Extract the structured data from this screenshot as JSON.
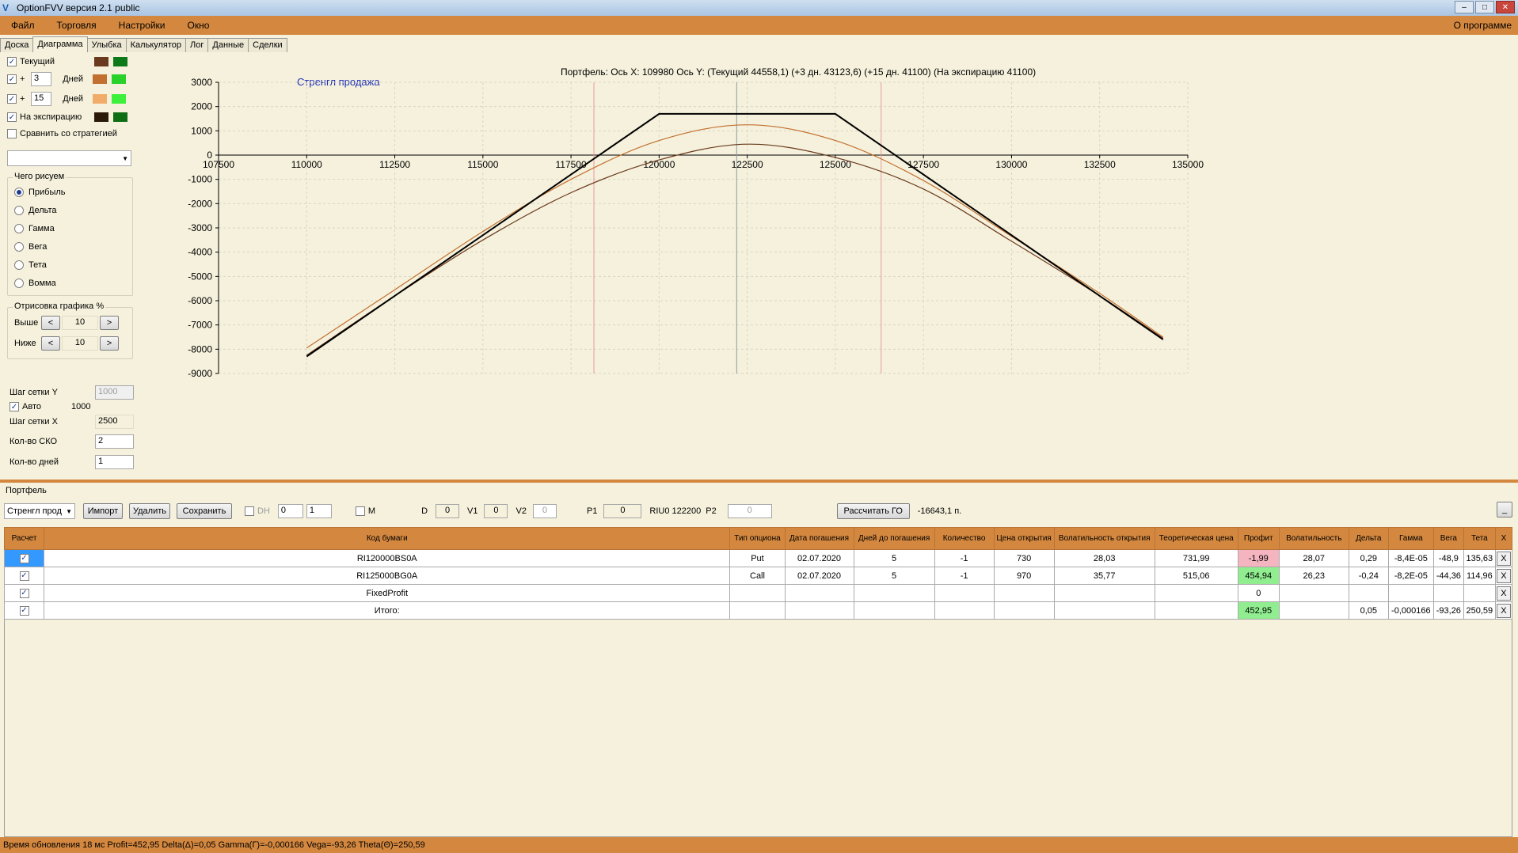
{
  "window": {
    "title": "OptionFVV версия 2.1 public"
  },
  "menu": {
    "items": [
      "Файл",
      "Торговля",
      "Настройки",
      "Окно"
    ],
    "about": "О программе"
  },
  "tabs": [
    "Доска",
    "Диаграмма",
    "Улыбка",
    "Калькулятор",
    "Лог",
    "Данные",
    "Сделки"
  ],
  "active_tab": "Диаграмма",
  "left": {
    "current_label": "Текущий",
    "plus_label": "+",
    "days_label": "Дней",
    "days1": "3",
    "days2": "15",
    "expiry_label": "На экспирацию",
    "compare_label": "Сравнить со стратегией",
    "what_group": "Чего рисуем",
    "what_options": [
      "Прибыль",
      "Дельта",
      "Гамма",
      "Вега",
      "Тета",
      "Вомма"
    ],
    "draw_group": "Отрисовка графика %",
    "above_label": "Выше",
    "above_value": "10",
    "below_label": "Ниже",
    "below_value": "10",
    "prev_glyph": "<",
    "next_glyph": ">",
    "grid_y_label": "Шаг сетки Y",
    "grid_y_value": "1000",
    "auto_label": "Авто",
    "auto_value": "1000",
    "grid_x_label": "Шаг сетки X",
    "grid_x_value": "2500",
    "sko_label": "Кол-во СКО",
    "sko_value": "2",
    "days_count_label": "Кол-во дней",
    "days_count_value": "1",
    "colors": {
      "current": [
        "#6b3a1e",
        "#0d7a1a"
      ],
      "plus3": [
        "#c27030",
        "#2ad12a"
      ],
      "plus15": [
        "#f1ac6a",
        "#3cf03c"
      ],
      "expiry": [
        "#2b1a08",
        "#0e6e14"
      ]
    }
  },
  "chart": {
    "header": "Портфель: Ось X:  109980 Ось Y:  (Текущий 44558,1)  (+3 дн. 43123,6)  (+15 дн. 41100)  (На экспирацию 41100)",
    "strategy_name": "Стренгл продажа"
  },
  "chart_data": {
    "type": "line",
    "xlim": [
      107500,
      135000
    ],
    "ylim": [
      -9000,
      3000
    ],
    "x_ticks": [
      "107500",
      "110000",
      "112500",
      "115000",
      "117500",
      "120000",
      "122500",
      "125000",
      "127500",
      "130000",
      "132500",
      "135000"
    ],
    "y_ticks": [
      "3000",
      "2000",
      "1000",
      "0",
      "-1000",
      "-2000",
      "-3000",
      "-4000",
      "-5000",
      "-6000",
      "-7000",
      "-8000",
      "-9000"
    ],
    "grid": true,
    "vertical_markers": {
      "current_price": 122200,
      "sigma_low": 118150,
      "sigma_high": 126300
    },
    "series": [
      {
        "x": [
          110000,
          120000,
          125000,
          134300
        ],
        "y": [
          -8300,
          1700,
          1700,
          -7600
        ],
        "color": "#000000"
      },
      {
        "x": [
          110000,
          112500,
          115000,
          117500,
          120000,
          122500,
          125000,
          127500,
          130000,
          132500,
          134300
        ],
        "y": [
          -7950,
          -5550,
          -3150,
          -1000,
          600,
          1250,
          600,
          -1050,
          -3350,
          -5700,
          -7500
        ],
        "color": "#c27030"
      },
      {
        "x": [
          110000,
          112500,
          115000,
          117500,
          120000,
          122500,
          125000,
          127500,
          130000,
          132500,
          134300
        ],
        "y": [
          -8250,
          -5800,
          -3500,
          -1550,
          -200,
          450,
          -100,
          -1400,
          -3550,
          -5800,
          -7550
        ],
        "color": "#6b3a1e"
      }
    ]
  },
  "portfolio": {
    "label": "Портфель",
    "strategy_select": "Стренгл прод",
    "import_label": "Импорт",
    "delete_label": "Удалить",
    "save_label": "Сохранить",
    "dh_label": "DH",
    "spin1": "0",
    "spin2": "1",
    "m_label": "M",
    "d_label": "D",
    "d_value": "0",
    "v1_label": "V1",
    "v1_value": "0",
    "v2_label": "V2",
    "v2_value": "0",
    "p1_label": "P1",
    "p1_value": "0",
    "riu_label": "RIU0 122200",
    "p2_label": "P2",
    "p2_value": "0",
    "calc_label": "Рассчитать ГО",
    "go_value": "-16643,1 п.",
    "minimize_label": "_",
    "columns": [
      "Расчет",
      "Код бумаги",
      "Тип опциона",
      "Дата погашения",
      "Дней до погашения",
      "Количество",
      "Цена открытия",
      "Волатильность открытия",
      "Теоретическая цена",
      "Профит",
      "Волатильность",
      "Дельта",
      "Гамма",
      "Вега",
      "Тета",
      "X"
    ],
    "rows": [
      [
        "",
        "RI120000BS0A",
        "Put",
        "02.07.2020",
        "5",
        "-1",
        "730",
        "28,03",
        "731,99",
        "-1,99",
        "28,07",
        "0,29",
        "-8,4E-05",
        "-48,9",
        "135,63",
        "X"
      ],
      [
        "",
        "RI125000BG0A",
        "Call",
        "02.07.2020",
        "5",
        "-1",
        "970",
        "35,77",
        "515,06",
        "454,94",
        "26,23",
        "-0,24",
        "-8,2E-05",
        "-44,36",
        "114,96",
        "X"
      ],
      [
        "",
        "FixedProfit",
        "",
        "",
        "",
        "",
        "",
        "",
        "",
        "0",
        "",
        "",
        "",
        "",
        "",
        "X"
      ],
      [
        "",
        "Итого:",
        "",
        "",
        "",
        "",
        "",
        "",
        "",
        "452,95",
        "",
        "0,05",
        "-0,000166",
        "-93,26",
        "250,59",
        "X"
      ]
    ]
  },
  "status": "Время обновления 18 мс  Profit=452,95 Delta(Δ)=0,05 Gamma(Γ)=-0,000166 Vega=-93,26 Theta(Θ)=250,59"
}
